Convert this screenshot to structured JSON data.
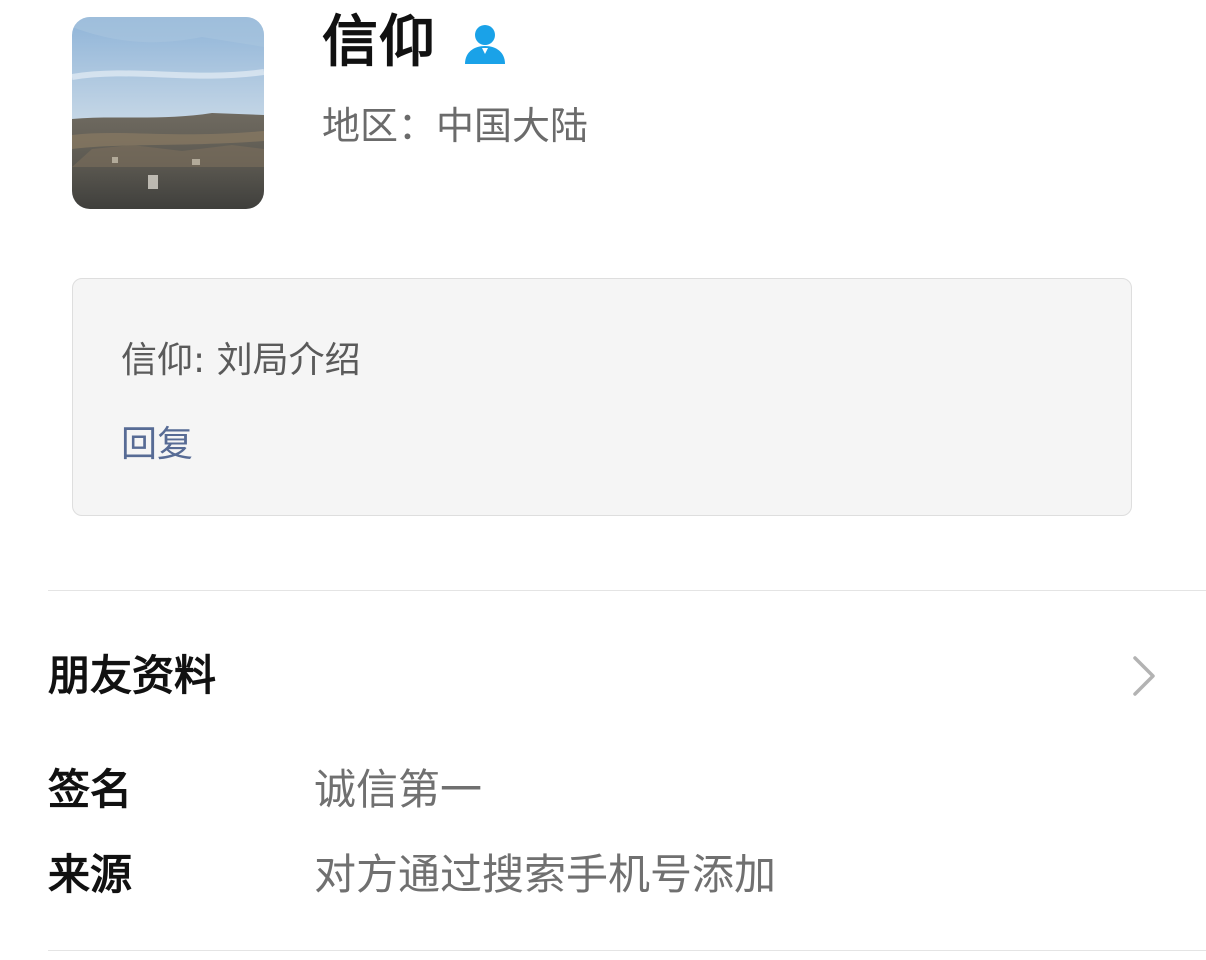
{
  "contact": {
    "name": "信仰",
    "region": "地区：中国大陆",
    "avatar_icon": "landscape-photo",
    "badge_icon": "person-icon",
    "badge_color": "#1aa2e8"
  },
  "greeting": {
    "message": "信仰: 刘局介绍",
    "reply_label": "回复",
    "reply_color": "#576b95"
  },
  "profile": {
    "title": "朋友资料",
    "chevron_icon": "chevron-right-icon",
    "rows": [
      {
        "label": "签名",
        "value": "诚信第一"
      },
      {
        "label": "来源",
        "value": "对方通过搜索手机号添加"
      }
    ]
  }
}
